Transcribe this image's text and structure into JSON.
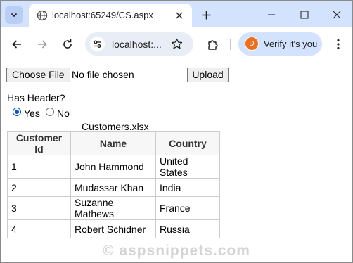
{
  "browser": {
    "tab_title": "localhost:65249/CS.aspx",
    "url": "localhost:...",
    "verify_label": "Verify it's you",
    "avatar_letter": "D"
  },
  "form": {
    "choose_file_label": "Choose File",
    "file_status": "No file chosen",
    "upload_label": "Upload",
    "has_header_label": "Has Header?",
    "yes_label": "Yes",
    "no_label": "No",
    "selected_option": "Yes"
  },
  "table": {
    "caption": "Customers.xlsx",
    "headers": [
      "Customer Id",
      "Name",
      "Country"
    ],
    "rows": [
      [
        "1",
        "John Hammond",
        "United States"
      ],
      [
        "2",
        "Mudassar Khan",
        "India"
      ],
      [
        "3",
        "Suzanne Mathews",
        "France"
      ],
      [
        "4",
        "Robert Schidner",
        "Russia"
      ]
    ]
  },
  "watermark": "© aspsnippets.com",
  "colors": {
    "tabstrip": "#d3e3fd",
    "omnibox": "#e9eef6",
    "radio_selected": "#0b57d0",
    "avatar": "#ee6e1c"
  }
}
